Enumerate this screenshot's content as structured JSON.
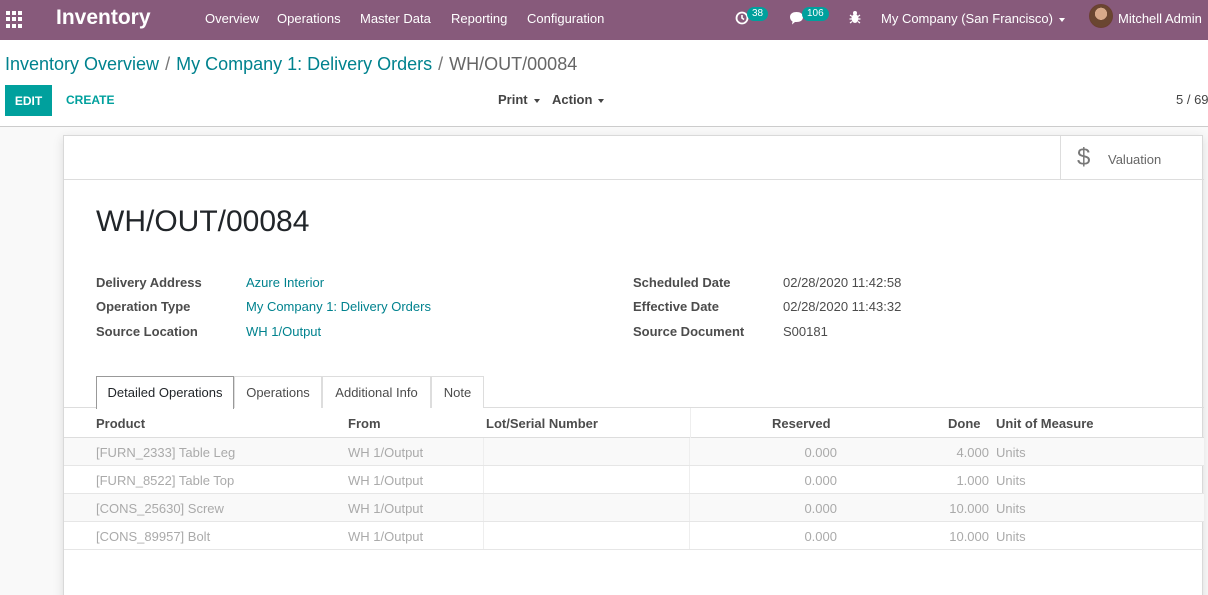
{
  "navbar": {
    "app_name": "Inventory",
    "menu": [
      "Overview",
      "Operations",
      "Master Data",
      "Reporting",
      "Configuration"
    ],
    "activity_badge": "38",
    "messages_badge": "106",
    "company": "My Company (San Francisco)",
    "user": "Mitchell Admin",
    "color": "#875a7b"
  },
  "breadcrumb": {
    "items": [
      "Inventory Overview",
      "My Company 1: Delivery Orders"
    ],
    "current": "WH/OUT/00084",
    "separator": "/"
  },
  "toolbar": {
    "edit_label": "EDIT",
    "create_label": "CREATE",
    "print_label": "Print",
    "action_label": "Action",
    "pager": "5 / 69",
    "accent": "#00a09d"
  },
  "smart_buttons": {
    "valuation_label": "Valuation",
    "valuation_icon": "$"
  },
  "record": {
    "title": "WH/OUT/00084",
    "left_fields": [
      {
        "label": "Delivery Address",
        "value": "Azure Interior"
      },
      {
        "label": "Operation Type",
        "value": "My Company 1: Delivery Orders"
      },
      {
        "label": "Source Location",
        "value": "WH 1/Output"
      }
    ],
    "right_fields": [
      {
        "label": "Scheduled Date",
        "value": "02/28/2020 11:42:58"
      },
      {
        "label": "Effective Date",
        "value": "02/28/2020 11:43:32"
      },
      {
        "label": "Source Document",
        "value": "S00181"
      }
    ]
  },
  "tabs": [
    "Detailed Operations",
    "Operations",
    "Additional Info",
    "Note"
  ],
  "table": {
    "columns": [
      "Product",
      "From",
      "Lot/Serial Number",
      "Reserved",
      "Done",
      "Unit of Measure"
    ],
    "rows": [
      {
        "product": "[FURN_2333] Table Leg",
        "from": "WH 1/Output",
        "lot": "",
        "reserved": "0.000",
        "done": "4.000",
        "uom": "Units"
      },
      {
        "product": "[FURN_8522] Table Top",
        "from": "WH 1/Output",
        "lot": "",
        "reserved": "0.000",
        "done": "1.000",
        "uom": "Units"
      },
      {
        "product": "[CONS_25630] Screw",
        "from": "WH 1/Output",
        "lot": "",
        "reserved": "0.000",
        "done": "10.000",
        "uom": "Units"
      },
      {
        "product": "[CONS_89957] Bolt",
        "from": "WH 1/Output",
        "lot": "",
        "reserved": "0.000",
        "done": "10.000",
        "uom": "Units"
      }
    ]
  }
}
